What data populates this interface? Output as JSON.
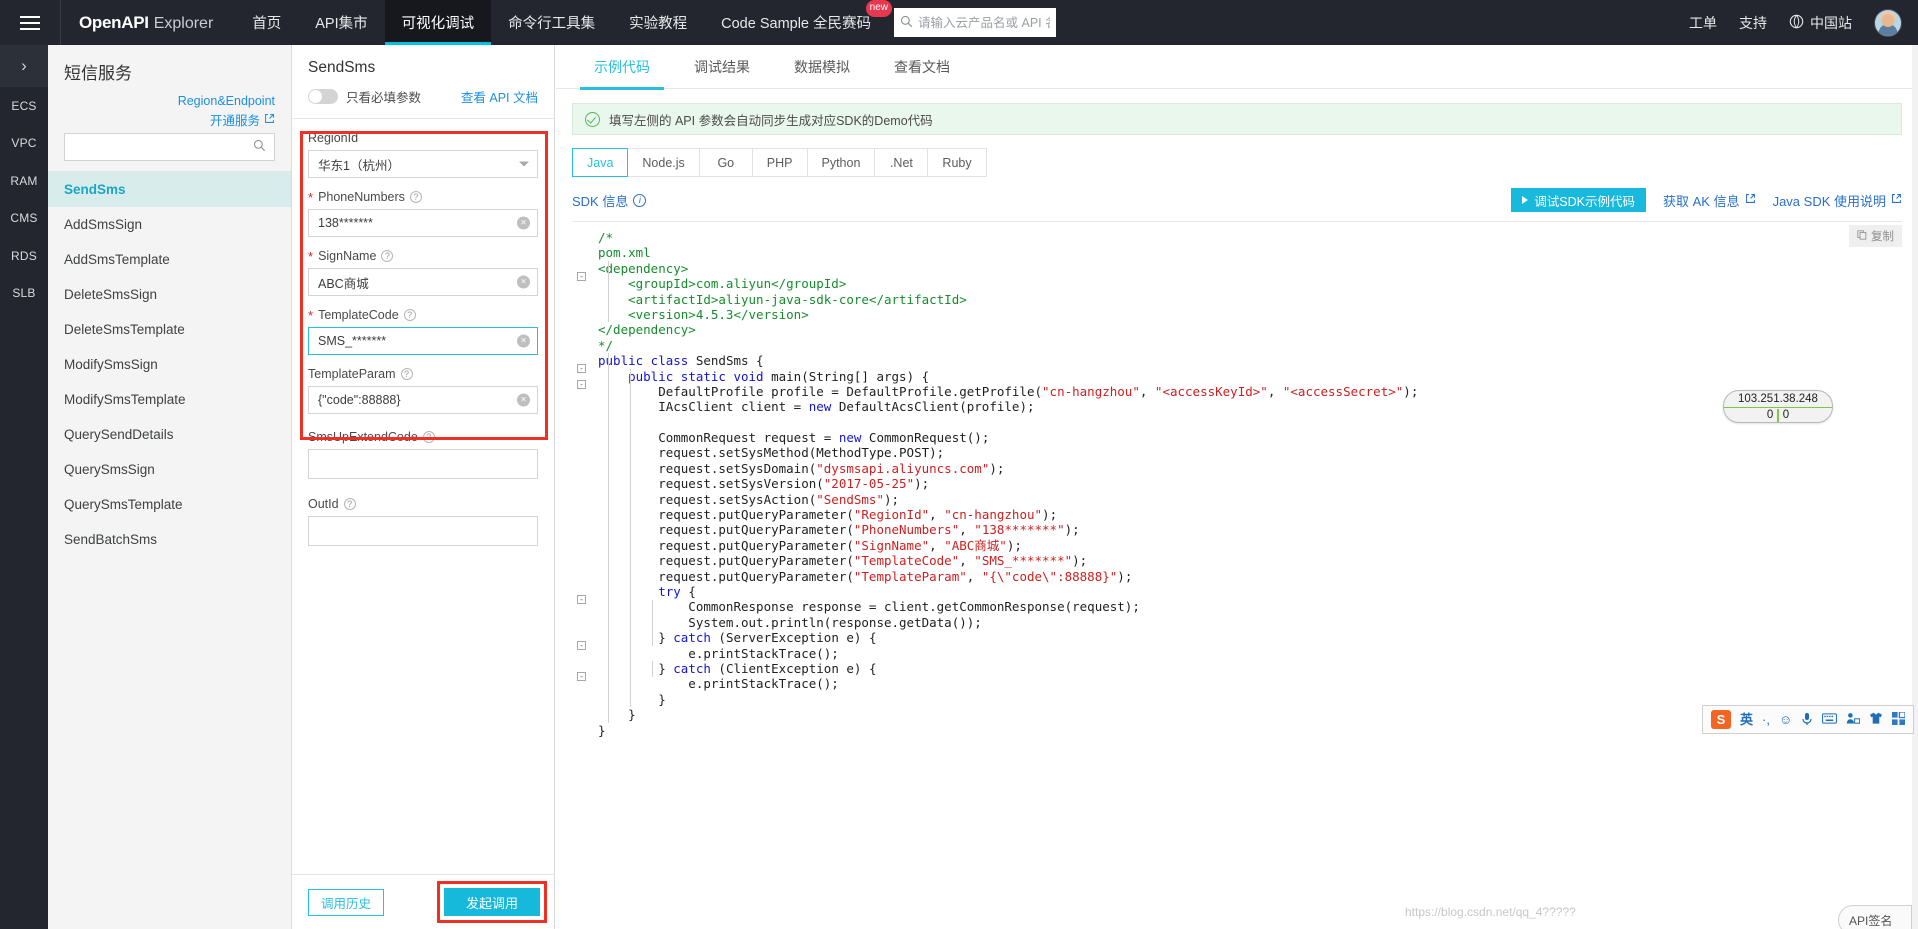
{
  "topnav": {
    "menu_icon": "hamburger-icon",
    "logo_bold": "OpenAPI",
    "logo_light": "Explorer",
    "items": [
      {
        "label": "首页",
        "active": false,
        "badge": ""
      },
      {
        "label": "API集市",
        "active": false,
        "badge": ""
      },
      {
        "label": "可视化调试",
        "active": true,
        "badge": ""
      },
      {
        "label": "命令行工具集",
        "active": false,
        "badge": ""
      },
      {
        "label": "实验教程",
        "active": false,
        "badge": ""
      },
      {
        "label": "Code Sample 全民赛码",
        "active": false,
        "badge": "new"
      }
    ],
    "search_placeholder": "请输入云产品名或 API 名称、",
    "search_value": "",
    "right_items": [
      "工单",
      "支持"
    ],
    "site_label": "中国站",
    "accent": "#00c1de",
    "background": "#23262e"
  },
  "rail": {
    "toggle_icon": "chevron-right-icon",
    "items": [
      "ECS",
      "VPC",
      "RAM",
      "CMS",
      "RDS",
      "SLB"
    ]
  },
  "api_panel": {
    "service_title": "短信服务",
    "link_region_endpoint": "Region&Endpoint",
    "link_open_service": "开通服务",
    "search_value": "",
    "search_placeholder": "",
    "items": [
      {
        "label": "SendSms",
        "active": true
      },
      {
        "label": "AddSmsSign",
        "active": false
      },
      {
        "label": "AddSmsTemplate",
        "active": false
      },
      {
        "label": "DeleteSmsSign",
        "active": false
      },
      {
        "label": "DeleteSmsTemplate",
        "active": false
      },
      {
        "label": "ModifySmsSign",
        "active": false
      },
      {
        "label": "ModifySmsTemplate",
        "active": false
      },
      {
        "label": "QuerySendDetails",
        "active": false
      },
      {
        "label": "QuerySmsSign",
        "active": false
      },
      {
        "label": "QuerySmsTemplate",
        "active": false
      },
      {
        "label": "SendBatchSms",
        "active": false
      }
    ]
  },
  "form": {
    "title": "SendSms",
    "toggle_label": "只看必填参数",
    "toggle_on": false,
    "doc_link": "查看 API 文档",
    "fields": [
      {
        "name": "RegionId",
        "required": false,
        "has_help": false,
        "value": "华东1（杭州）",
        "control": "select",
        "focused": false
      },
      {
        "name": "PhoneNumbers",
        "required": true,
        "has_help": true,
        "value": "138*******",
        "control": "input",
        "focused": false
      },
      {
        "name": "SignName",
        "required": true,
        "has_help": true,
        "value": "ABC商城",
        "control": "input",
        "focused": false
      },
      {
        "name": "TemplateCode",
        "required": true,
        "has_help": true,
        "value": "SMS_*******",
        "control": "input",
        "focused": true
      },
      {
        "name": "TemplateParam",
        "required": false,
        "has_help": true,
        "value": "{\"code\":88888}",
        "control": "input",
        "focused": false
      },
      {
        "name": "SmsUpExtendCode",
        "required": false,
        "has_help": true,
        "value": "",
        "control": "input",
        "focused": false
      },
      {
        "name": "OutId",
        "required": false,
        "has_help": true,
        "value": "",
        "control": "input",
        "focused": false
      }
    ],
    "history_button": "调用历史",
    "submit_button": "发起调用",
    "highlight_color": "#ee3124"
  },
  "content": {
    "tabs": [
      {
        "label": "示例代码",
        "active": true
      },
      {
        "label": "调试结果",
        "active": false
      },
      {
        "label": "数据模拟",
        "active": false
      },
      {
        "label": "查看文档",
        "active": false
      }
    ],
    "notice": "填写左侧的 API 参数会自动同步生成对应SDK的Demo代码",
    "languages": [
      {
        "label": "Java",
        "active": true
      },
      {
        "label": "Node.js",
        "active": false
      },
      {
        "label": "Go",
        "active": false
      },
      {
        "label": "PHP",
        "active": false
      },
      {
        "label": "Python",
        "active": false
      },
      {
        "label": ".Net",
        "active": false
      },
      {
        "label": "Ruby",
        "active": false
      }
    ],
    "sdk_info_label": "SDK 信息",
    "debug_button": "调试SDK示例代码",
    "ak_link": "获取 AK 信息",
    "sdk_doc_link": "Java SDK 使用说明",
    "copy_label": "复制",
    "code_lines": [
      {
        "indent": 1,
        "fold": "",
        "tokens": [
          {
            "t": "/*",
            "c": "cmt"
          }
        ]
      },
      {
        "indent": 1,
        "fold": "",
        "tokens": [
          {
            "t": "pom.xml",
            "c": "cmt"
          }
        ]
      },
      {
        "indent": 1,
        "fold": "-",
        "tokens": [
          {
            "t": "<dependency>",
            "c": "cmt"
          }
        ]
      },
      {
        "indent": 2,
        "fold": "",
        "tokens": [
          {
            "t": "    <groupId>com.aliyun</groupId>",
            "c": "cmt"
          }
        ]
      },
      {
        "indent": 2,
        "fold": "",
        "tokens": [
          {
            "t": "    <artifactId>aliyun-java-sdk-core</artifactId>",
            "c": "cmt"
          }
        ]
      },
      {
        "indent": 2,
        "fold": "",
        "tokens": [
          {
            "t": "    <version>4.5.3</version>",
            "c": "cmt"
          }
        ]
      },
      {
        "indent": 1,
        "fold": "",
        "tokens": [
          {
            "t": "</dependency>",
            "c": "cmt"
          }
        ]
      },
      {
        "indent": 1,
        "fold": "",
        "tokens": [
          {
            "t": "*/",
            "c": "cmt"
          }
        ]
      },
      {
        "indent": 0,
        "fold": "-",
        "tokens": [
          {
            "t": "public class",
            "c": "kw"
          },
          {
            "t": " SendSms {",
            "c": "pln"
          }
        ]
      },
      {
        "indent": 1,
        "fold": "-",
        "tokens": [
          {
            "t": "    ",
            "c": "pln"
          },
          {
            "t": "public static void",
            "c": "kw"
          },
          {
            "t": " main(String[] args) {",
            "c": "pln"
          }
        ]
      },
      {
        "indent": 2,
        "fold": "",
        "tokens": [
          {
            "t": "        DefaultProfile profile = DefaultProfile.getProfile(",
            "c": "pln"
          },
          {
            "t": "\"cn-hangzhou\"",
            "c": "str"
          },
          {
            "t": ", ",
            "c": "pln"
          },
          {
            "t": "\"<accessKeyId>\"",
            "c": "str"
          },
          {
            "t": ", ",
            "c": "pln"
          },
          {
            "t": "\"<accessSecret>\"",
            "c": "str"
          },
          {
            "t": ");",
            "c": "pln"
          }
        ]
      },
      {
        "indent": 2,
        "fold": "",
        "tokens": [
          {
            "t": "        IAcsClient client = ",
            "c": "pln"
          },
          {
            "t": "new",
            "c": "kw"
          },
          {
            "t": " DefaultAcsClient(profile);",
            "c": "pln"
          }
        ]
      },
      {
        "indent": 2,
        "fold": "",
        "tokens": [
          {
            "t": "",
            "c": "pln"
          }
        ]
      },
      {
        "indent": 2,
        "fold": "",
        "tokens": [
          {
            "t": "        CommonRequest request = ",
            "c": "pln"
          },
          {
            "t": "new",
            "c": "kw"
          },
          {
            "t": " CommonRequest();",
            "c": "pln"
          }
        ]
      },
      {
        "indent": 2,
        "fold": "",
        "tokens": [
          {
            "t": "        request.setSysMethod(MethodType.POST);",
            "c": "pln"
          }
        ]
      },
      {
        "indent": 2,
        "fold": "",
        "tokens": [
          {
            "t": "        request.setSysDomain(",
            "c": "pln"
          },
          {
            "t": "\"dysmsapi.aliyuncs.com\"",
            "c": "str"
          },
          {
            "t": ");",
            "c": "pln"
          }
        ]
      },
      {
        "indent": 2,
        "fold": "",
        "tokens": [
          {
            "t": "        request.setSysVersion(",
            "c": "pln"
          },
          {
            "t": "\"2017-05-25\"",
            "c": "str"
          },
          {
            "t": ");",
            "c": "pln"
          }
        ]
      },
      {
        "indent": 2,
        "fold": "",
        "tokens": [
          {
            "t": "        request.setSysAction(",
            "c": "pln"
          },
          {
            "t": "\"SendSms\"",
            "c": "str"
          },
          {
            "t": ");",
            "c": "pln"
          }
        ]
      },
      {
        "indent": 2,
        "fold": "",
        "tokens": [
          {
            "t": "        request.putQueryParameter(",
            "c": "pln"
          },
          {
            "t": "\"RegionId\"",
            "c": "str"
          },
          {
            "t": ", ",
            "c": "pln"
          },
          {
            "t": "\"cn-hangzhou\"",
            "c": "str"
          },
          {
            "t": ");",
            "c": "pln"
          }
        ]
      },
      {
        "indent": 2,
        "fold": "",
        "tokens": [
          {
            "t": "        request.putQueryParameter(",
            "c": "pln"
          },
          {
            "t": "\"PhoneNumbers\"",
            "c": "str"
          },
          {
            "t": ", ",
            "c": "pln"
          },
          {
            "t": "\"138*******\"",
            "c": "str"
          },
          {
            "t": ");",
            "c": "pln"
          }
        ]
      },
      {
        "indent": 2,
        "fold": "",
        "tokens": [
          {
            "t": "        request.putQueryParameter(",
            "c": "pln"
          },
          {
            "t": "\"SignName\"",
            "c": "str"
          },
          {
            "t": ", ",
            "c": "pln"
          },
          {
            "t": "\"ABC商城\"",
            "c": "str"
          },
          {
            "t": ");",
            "c": "pln"
          }
        ]
      },
      {
        "indent": 2,
        "fold": "",
        "tokens": [
          {
            "t": "        request.putQueryParameter(",
            "c": "pln"
          },
          {
            "t": "\"TemplateCode\"",
            "c": "str"
          },
          {
            "t": ", ",
            "c": "pln"
          },
          {
            "t": "\"SMS_*******\"",
            "c": "str"
          },
          {
            "t": ");",
            "c": "pln"
          }
        ]
      },
      {
        "indent": 2,
        "fold": "",
        "tokens": [
          {
            "t": "        request.putQueryParameter(",
            "c": "pln"
          },
          {
            "t": "\"TemplateParam\"",
            "c": "str"
          },
          {
            "t": ", ",
            "c": "pln"
          },
          {
            "t": "\"{\\\"code\\\":88888}\"",
            "c": "str"
          },
          {
            "t": ");",
            "c": "pln"
          }
        ]
      },
      {
        "indent": 2,
        "fold": "-",
        "tokens": [
          {
            "t": "        ",
            "c": "pln"
          },
          {
            "t": "try",
            "c": "kw"
          },
          {
            "t": " {",
            "c": "pln"
          }
        ]
      },
      {
        "indent": 3,
        "fold": "",
        "tokens": [
          {
            "t": "            CommonResponse response = client.getCommonResponse(request);",
            "c": "pln"
          }
        ]
      },
      {
        "indent": 3,
        "fold": "",
        "tokens": [
          {
            "t": "            System.out.println(response.getData());",
            "c": "pln"
          }
        ]
      },
      {
        "indent": 2,
        "fold": "-",
        "tokens": [
          {
            "t": "        } ",
            "c": "pln"
          },
          {
            "t": "catch",
            "c": "kw"
          },
          {
            "t": " (ServerException e) {",
            "c": "pln"
          }
        ]
      },
      {
        "indent": 3,
        "fold": "",
        "tokens": [
          {
            "t": "            e.printStackTrace();",
            "c": "pln"
          }
        ]
      },
      {
        "indent": 2,
        "fold": "-",
        "tokens": [
          {
            "t": "        } ",
            "c": "pln"
          },
          {
            "t": "catch",
            "c": "kw"
          },
          {
            "t": " (ClientException e) {",
            "c": "pln"
          }
        ]
      },
      {
        "indent": 3,
        "fold": "",
        "tokens": [
          {
            "t": "            e.printStackTrace();",
            "c": "pln"
          }
        ]
      },
      {
        "indent": 2,
        "fold": "",
        "tokens": [
          {
            "t": "        }",
            "c": "pln"
          }
        ]
      },
      {
        "indent": 1,
        "fold": "",
        "tokens": [
          {
            "t": "    }",
            "c": "pln"
          }
        ]
      },
      {
        "indent": 0,
        "fold": "",
        "tokens": [
          {
            "t": "}",
            "c": "pln"
          }
        ]
      }
    ]
  },
  "floating": {
    "ip_address": "103.251.38.248",
    "ip_num_left": "0",
    "ip_num_right": "0",
    "ime_logo": "S",
    "ime_mode": "英",
    "ime_icons": [
      "comma-icon",
      "smiley-icon",
      "microphone-icon",
      "keyboard-icon",
      "toolbox-icon",
      "skin-icon",
      "apps-icon"
    ],
    "api_sign_label": "API签名",
    "watermark": "https://blog.csdn.net/qq_4?????"
  }
}
